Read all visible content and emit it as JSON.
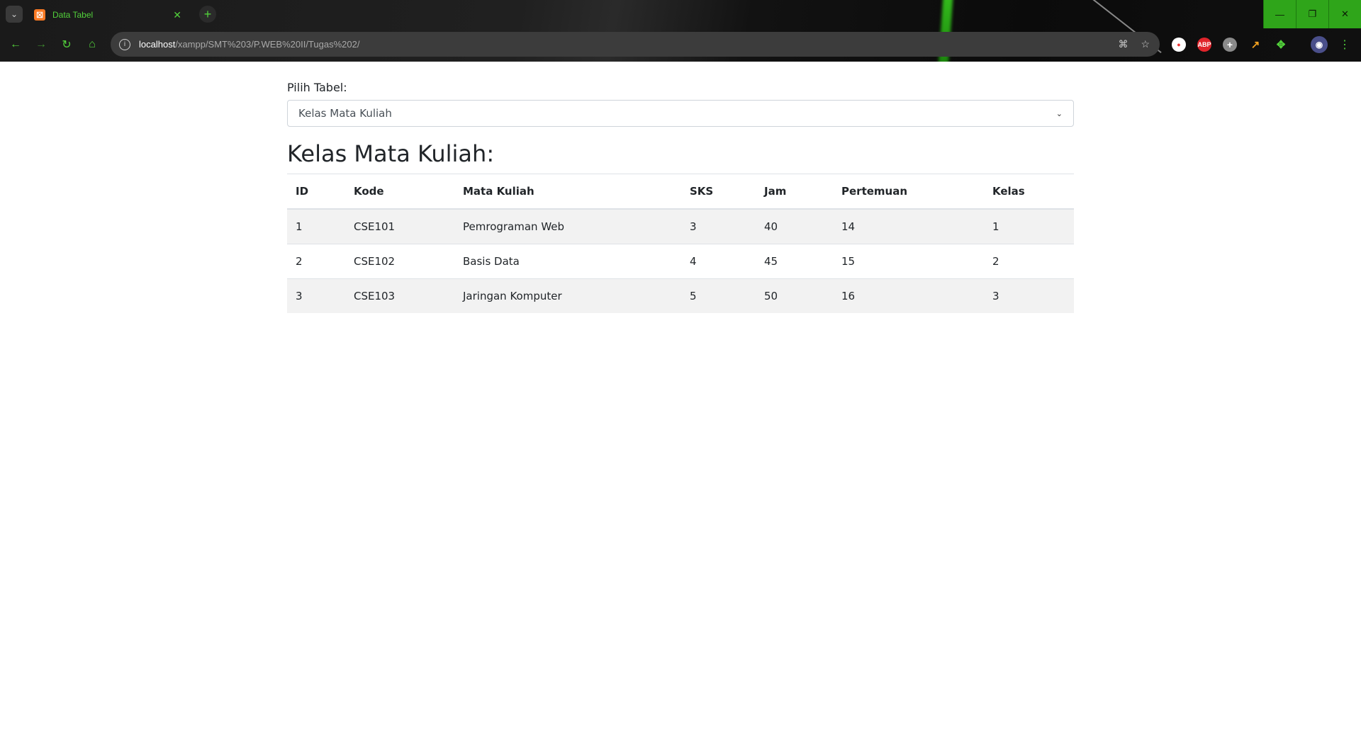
{
  "browser": {
    "tab_title": "Data Tabel",
    "url_host": "localhost",
    "url_path": "/xampp/SMT%203/P.WEB%20II/Tugas%202/",
    "accent": "#52d13b"
  },
  "page": {
    "select_label": "Pilih Tabel:",
    "select_value": "Kelas Mata Kuliah",
    "heading": "Kelas Mata Kuliah:",
    "table": {
      "headers": [
        "ID",
        "Kode",
        "Mata Kuliah",
        "SKS",
        "Jam",
        "Pertemuan",
        "Kelas"
      ],
      "rows": [
        [
          "1",
          "CSE101",
          "Pemrograman Web",
          "3",
          "40",
          "14",
          "1"
        ],
        [
          "2",
          "CSE102",
          "Basis Data",
          "4",
          "45",
          "15",
          "2"
        ],
        [
          "3",
          "CSE103",
          "Jaringan Komputer",
          "5",
          "50",
          "16",
          "3"
        ]
      ]
    }
  }
}
